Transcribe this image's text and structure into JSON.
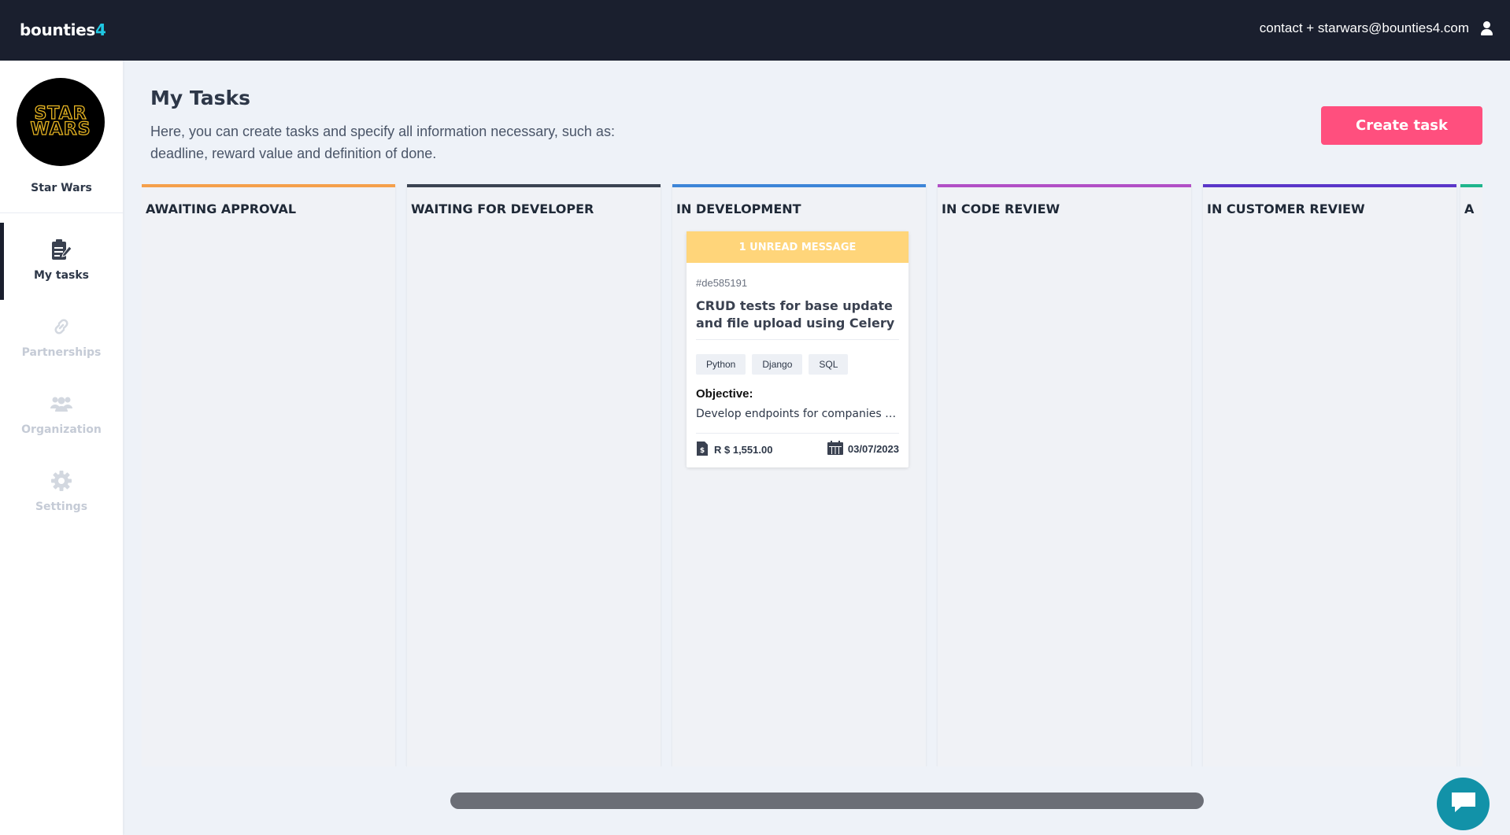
{
  "topbar": {
    "logo_main": "bounties",
    "logo_accent": "4",
    "user_email": "contact + starwars@bounties4.com",
    "user_icon": "user-icon"
  },
  "sidebar": {
    "org_logo_line1": "STAR",
    "org_logo_line2": "WARS",
    "org_name": "Star Wars",
    "items": [
      {
        "label": "My tasks",
        "icon": "task-edit-icon",
        "active": true
      },
      {
        "label": "Partnerships",
        "icon": "link-icon",
        "active": false
      },
      {
        "label": "Organization",
        "icon": "users-icon",
        "active": false
      },
      {
        "label": "Settings",
        "icon": "gear-icon",
        "active": false
      }
    ]
  },
  "header": {
    "title": "My Tasks",
    "description": "Here, you can create tasks and specify all information necessary, such as: deadline, reward value and definition of done.",
    "create_button": "Create task"
  },
  "columns": [
    {
      "title": "AWAITING APPROVAL",
      "color": "#f5a04b"
    },
    {
      "title": "WAITING FOR DEVELOPER",
      "color": "#3b4452"
    },
    {
      "title": "IN DEVELOPMENT",
      "color": "#3d85d8"
    },
    {
      "title": "IN CODE REVIEW",
      "color": "#b14fc6"
    },
    {
      "title": "IN CUSTOMER REVIEW",
      "color": "#5a36c9"
    },
    {
      "title": "A",
      "color": "#1eb58c"
    }
  ],
  "card": {
    "banner": "1 UNREAD MESSAGE",
    "id": "#de585191",
    "title": "CRUD tests for base update and file upload using Celery",
    "tags": [
      "Python",
      "Django",
      "SQL"
    ],
    "objective_label": "Objective:",
    "objective_text": "Develop endpoints for companies to upload files",
    "reward": "R $ 1,551.00",
    "deadline": "03/07/2023",
    "reward_icon": "money-document-icon",
    "deadline_icon": "calendar-icon"
  },
  "chat": {
    "icon": "chat-bubble-icon"
  }
}
